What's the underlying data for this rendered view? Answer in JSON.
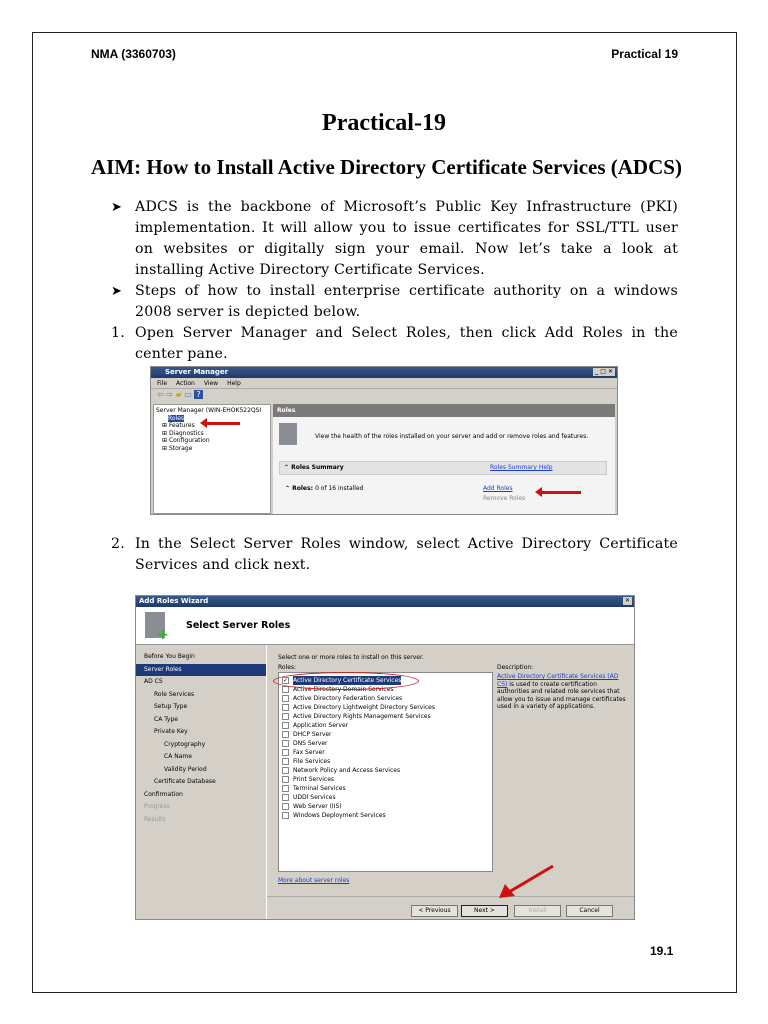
{
  "header": {
    "left": "NMA (3360703)",
    "right": "Practical 19"
  },
  "title": "Practical-19",
  "aim": "AIM: How to Install Active Directory Certificate Services (ADCS)",
  "bullets": [
    "ADCS is the backbone of Microsoft’s Public Key Infrastructure (PKI) implementation. It will allow you to issue certificates for SSL/TTL user on websites or digitally sign your email. Now let’s take a look at installing Active Directory Certificate Services.",
    "Steps of how to install enterprise certificate authority on a windows 2008 server is depicted below."
  ],
  "steps": [
    {
      "num": "1.",
      "text": "Open Server Manager and Select Roles, then click Add Roles in the center pane."
    },
    {
      "num": "2.",
      "text": "In the Select Server Roles window, select Active Directory Certificate Services and click next."
    }
  ],
  "server_manager": {
    "title": "Server Manager",
    "menu": [
      "File",
      "Action",
      "View",
      "Help"
    ],
    "tree": [
      "Server Manager (WIN-EHOK522QSI",
      "Roles",
      "Features",
      "Diagnostics",
      "Configuration",
      "Storage"
    ],
    "pane_title": "Roles",
    "description": "View the health of the roles installed on your server and add or remove roles and features.",
    "summary_label": "Roles Summary",
    "summary_help": "Roles Summary Help",
    "roles_label": "Roles:",
    "roles_count": "0 of 16 installed",
    "add_roles": "Add Roles",
    "remove_roles": "Remove Roles"
  },
  "wizard": {
    "title": "Add Roles Wizard",
    "heading": "Select Server Roles",
    "steps": [
      "Before You Begin",
      "Server Roles",
      "AD CS",
      "Role Services",
      "Setup Type",
      "CA Type",
      "Private Key",
      "Cryptography",
      "CA Name",
      "Validity Period",
      "Certificate Database",
      "Confirmation",
      "Progress",
      "Results"
    ],
    "instruction": "Select one or more roles to install on this server.",
    "roles_label": "Roles:",
    "roles": [
      "Active Directory Certificate Services",
      "Active Directory Domain Services",
      "Active Directory Federation Services",
      "Active Directory Lightweight Directory Services",
      "Active Directory Rights Management Services",
      "Application Server",
      "DHCP Server",
      "DNS Server",
      "Fax Server",
      "File Services",
      "Network Policy and Access Services",
      "Print Services",
      "Terminal Services",
      "UDDI Services",
      "Web Server (IIS)",
      "Windows Deployment Services"
    ],
    "description_label": "Description:",
    "description_link": "Active Directory Certificate Services (AD CS)",
    "description_text": " is used to create certification authorities and related role services that allow you to issue and manage certificates used in a variety of applications.",
    "more_link": "More about server roles",
    "buttons": {
      "previous": "< Previous",
      "next": "Next >",
      "install": "Install",
      "cancel": "Cancel"
    }
  },
  "page_number": "19.1"
}
